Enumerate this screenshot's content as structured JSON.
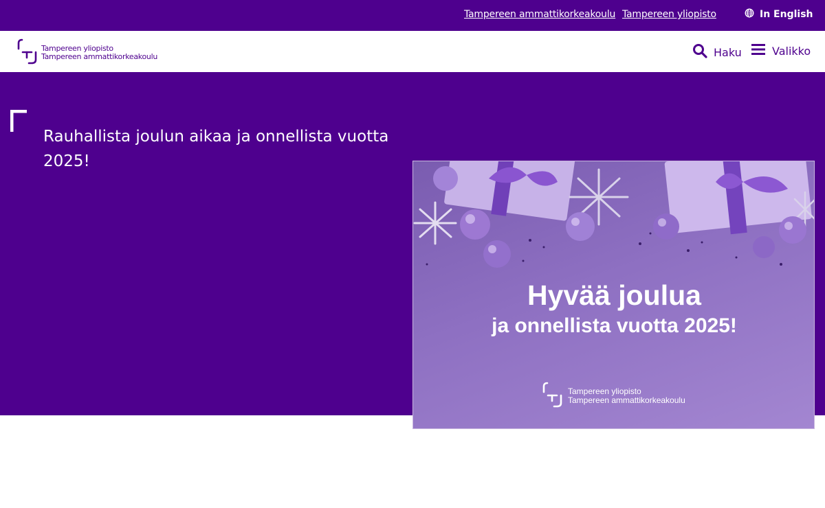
{
  "topbar": {
    "link_tamk": "Tampereen ammattikorkeakoulu",
    "link_tuni": "Tampereen yliopisto",
    "language_label": "In English",
    "language_icon": "globe-icon"
  },
  "header": {
    "logo_line1": "Tampereen yliopisto",
    "logo_line2": "Tampereen ammattikorkeakoulu",
    "search_label": "Haku",
    "search_icon": "search-icon",
    "menu_label": "Valikko",
    "menu_icon": "hamburger-icon"
  },
  "hero": {
    "title": "Rauhallista joulun aikaa ja onnellista vuotta 2025!"
  },
  "card": {
    "headline": "Hyvää joulua",
    "subline": "ja onnellista vuotta 2025!",
    "logo_line1": "Tampereen yliopisto",
    "logo_line2": "Tampereen ammattikorkeakoulu"
  },
  "colors": {
    "brand_purple": "#4e008e",
    "white": "#ffffff",
    "card_lilac": "#8e70c2"
  }
}
